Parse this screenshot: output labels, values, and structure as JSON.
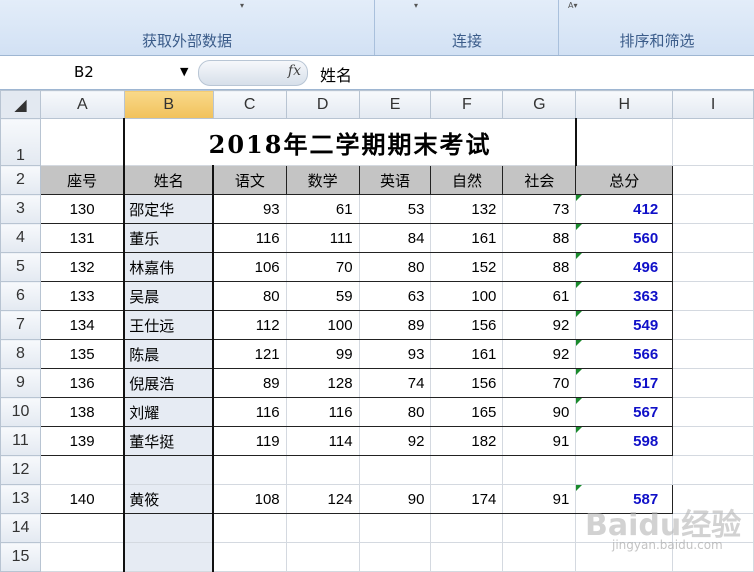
{
  "ribbon": {
    "groups": [
      {
        "label": "获取外部数据"
      },
      {
        "label": "连接"
      },
      {
        "label": "排序和筛选"
      }
    ]
  },
  "formula_bar": {
    "name_box": "B2",
    "fx_symbol": "fx",
    "content": "姓名"
  },
  "columns": [
    "A",
    "B",
    "C",
    "D",
    "E",
    "F",
    "G",
    "H",
    "I"
  ],
  "rows": [
    "1",
    "2",
    "3",
    "4",
    "5",
    "6",
    "7",
    "8",
    "9",
    "10",
    "11",
    "12",
    "13",
    "14",
    "15"
  ],
  "sheet": {
    "title": "2018年二学期期末考试",
    "headers": [
      "座号",
      "姓名",
      "语文",
      "数学",
      "英语",
      "自然",
      "社会",
      "总分"
    ],
    "data": [
      [
        "130",
        "邵定华",
        "93",
        "61",
        "53",
        "132",
        "73",
        "412"
      ],
      [
        "131",
        "董乐",
        "116",
        "111",
        "84",
        "161",
        "88",
        "560"
      ],
      [
        "132",
        "林嘉伟",
        "106",
        "70",
        "80",
        "152",
        "88",
        "496"
      ],
      [
        "133",
        "吴晨",
        "80",
        "59",
        "63",
        "100",
        "61",
        "363"
      ],
      [
        "134",
        "王仕远",
        "112",
        "100",
        "89",
        "156",
        "92",
        "549"
      ],
      [
        "135",
        "陈晨",
        "121",
        "99",
        "93",
        "161",
        "92",
        "566"
      ],
      [
        "136",
        "倪展浩",
        "89",
        "128",
        "74",
        "156",
        "70",
        "517"
      ],
      [
        "138",
        "刘耀",
        "116",
        "116",
        "80",
        "165",
        "90",
        "567"
      ],
      [
        "139",
        "董华挺",
        "119",
        "114",
        "92",
        "182",
        "91",
        "598"
      ]
    ],
    "row13": [
      "140",
      "黄筱",
      "108",
      "124",
      "90",
      "174",
      "91",
      "587"
    ]
  },
  "watermark": {
    "main": "Baidu经验",
    "sub": "jingyan.baidu.com"
  },
  "colors": {
    "total_text": "#1010c8",
    "header_fill": "#c4c4c4",
    "selected_col": "#f1c15b"
  }
}
